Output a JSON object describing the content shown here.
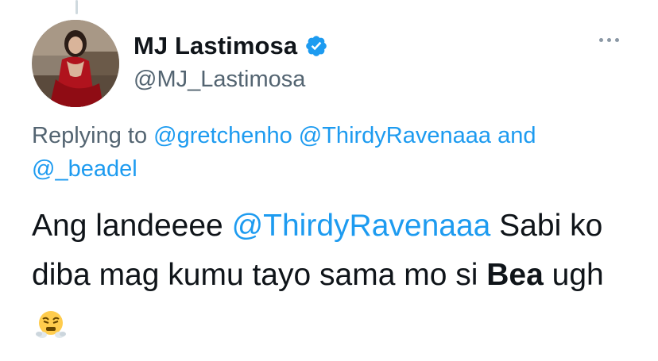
{
  "tweet": {
    "author": {
      "display_name": "MJ Lastimosa",
      "handle": "@MJ_Lastimosa",
      "verified": true
    },
    "reply_context": {
      "prefix": "Replying to",
      "mentions": [
        "@gretchenho",
        "@ThirdyRavenaaa",
        "@_beadel"
      ],
      "conjunction": "and"
    },
    "text": {
      "part1": "Ang landeeee",
      "mention": "@ThirdyRavenaaa",
      "part2": "Sabi ko diba mag kumu tayo sama mo si",
      "bold_word": "Bea",
      "part3": "ugh",
      "emoji": "face-with-steam-from-nose"
    },
    "colors": {
      "link": "#1d9bf0",
      "secondary_text": "#536471",
      "verified_badge": "#1d9bf0"
    }
  }
}
